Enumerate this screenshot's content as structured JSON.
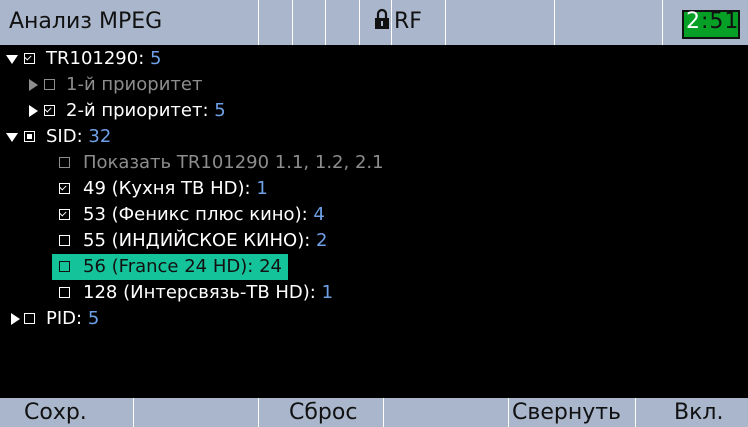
{
  "header": {
    "title": "Анализ MPEG",
    "rf_label": "RF",
    "clock_hours": "2",
    "clock_minutes": "51",
    "battery_color": "#06a026"
  },
  "tree": {
    "tr101290": {
      "label": "TR101290: ",
      "count": "5",
      "expanded": true,
      "checked": true
    },
    "priority1": {
      "label": "1-й приоритет",
      "dim": true
    },
    "priority2": {
      "label": "2-й приоритет: ",
      "count": "5"
    },
    "sid": {
      "label": "SID: ",
      "count": "32",
      "expanded": true
    },
    "show_tr": {
      "label": "Показать TR101290 1.1, 1.2, 2.1",
      "dim": true
    },
    "services": [
      {
        "label": "49 (Кухня ТВ HD): ",
        "count": "1",
        "checked": true
      },
      {
        "label": "53 (Феникс плюс кино): ",
        "count": "4",
        "checked": true
      },
      {
        "label": "55 (ИНДИЙСКОЕ КИНО): ",
        "count": "2",
        "checked": false
      },
      {
        "label": "56 (France 24 HD): ",
        "count": "24",
        "checked": false,
        "selected": true
      },
      {
        "label": "128 (Интерсвязь-ТВ HD): ",
        "count": "1",
        "checked": false
      }
    ],
    "pid": {
      "label": "PID: ",
      "count": "5",
      "expanded": false
    }
  },
  "softkeys": {
    "save": "Сохр.",
    "reset": "Сброс",
    "collapse": "Свернуть",
    "on": "Вкл."
  },
  "colors": {
    "bar": "#a9b6cb",
    "highlight": "#15c39a",
    "count": "#6ea0e8"
  }
}
